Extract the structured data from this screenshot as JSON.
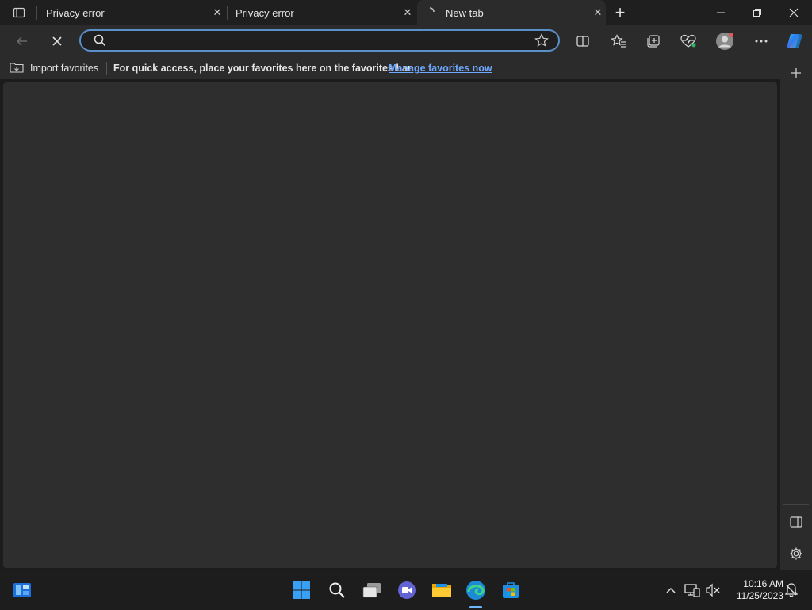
{
  "tabs": [
    {
      "title": "Privacy error",
      "close": "✕"
    },
    {
      "title": "Privacy error",
      "close": "✕"
    },
    {
      "title": "New tab",
      "close": "✕"
    }
  ],
  "new_tab_symbol": "+",
  "window": {
    "minimize": "—",
    "restore": "❐",
    "close": "✕"
  },
  "address": {
    "value": "",
    "placeholder": ""
  },
  "favorites_bar": {
    "import_label": "Import favorites",
    "prompt": "For quick access, place your favorites here on the favorites bar.",
    "manage_link": "Manage favorites now"
  },
  "taskbar": {
    "time": "10:16 AM",
    "date": "11/25/2023"
  },
  "colors": {
    "accent": "#5b8fc9",
    "link": "#6fa8ff"
  }
}
